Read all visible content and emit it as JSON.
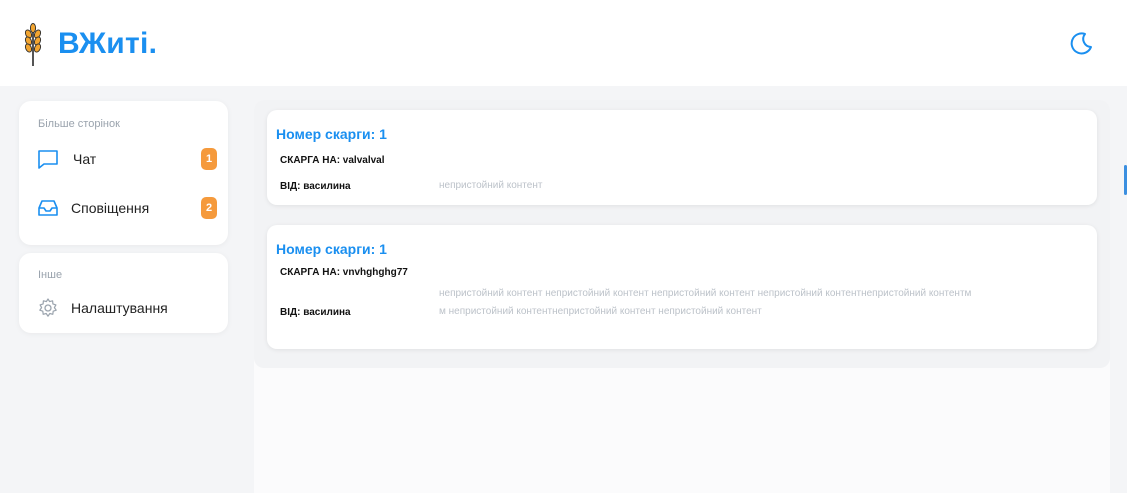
{
  "header": {
    "logo_text": "ВЖиті.",
    "logo_icon": "wheat-icon",
    "theme_icon": "moon-icon",
    "brand_color": "#1a8ff0"
  },
  "sidebar": {
    "more_pages": {
      "title": "Більше сторінок",
      "items": [
        {
          "label": "Чат",
          "icon": "chat-icon",
          "badge": "1"
        },
        {
          "label": "Сповіщення",
          "icon": "inbox-icon",
          "badge": "2"
        }
      ]
    },
    "other": {
      "title": "Інше",
      "items": [
        {
          "label": "Налаштування",
          "icon": "gear-icon"
        }
      ]
    },
    "badge_color": "#f59a3c"
  },
  "complaints": [
    {
      "title": "Номер скарги: 1",
      "against": "СКАРГА НА: valvalval",
      "from": "ВІД: василина",
      "content": "непристойний контент"
    },
    {
      "title": "Номер скарги: 1",
      "against": "СКАРГА НА: vnvhghghg77",
      "from": "ВІД: василина",
      "content": "непристойний контент непристойний контент непристойний контент непристойний контентнепристойний контентм м непристойний контентнепристойний контент непристойний контент"
    }
  ]
}
